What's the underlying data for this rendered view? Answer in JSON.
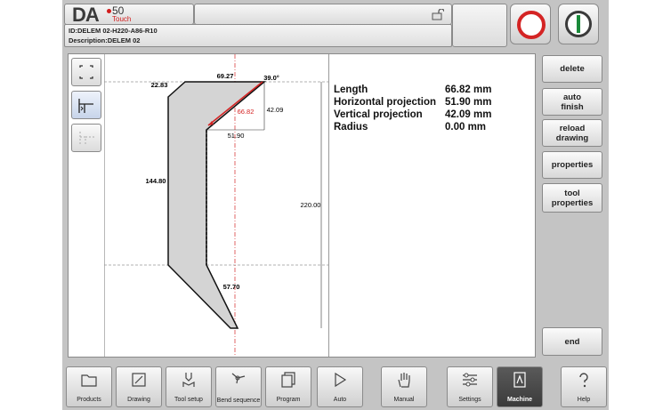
{
  "header": {
    "logo_main": "DA",
    "logo_number": "50",
    "logo_sub": "Touch",
    "product_id": "ID:DELEM 02-H220-A86-R10",
    "description": "Description:DELEM 02"
  },
  "drawing": {
    "dims": {
      "top_left": "22.83",
      "top": "69.27",
      "angle": "39.0°",
      "selected_length": "66.82",
      "vertical_proj": "42.09",
      "horizontal_proj": "51.90",
      "left": "144.80",
      "total_height": "220.00",
      "bottom": "57.70"
    }
  },
  "info": {
    "rows": [
      {
        "label": "Length",
        "value": "66.82 mm"
      },
      {
        "label": "Horizontal projection",
        "value": "51.90 mm"
      },
      {
        "label": "Vertical projection",
        "value": "42.09 mm"
      },
      {
        "label": "Radius",
        "value": "0.00 mm"
      }
    ]
  },
  "side_buttons": {
    "delete": "delete",
    "auto_finish": "auto\nfinish",
    "reload_drawing": "reload\ndrawing",
    "properties": "properties",
    "tool_properties": "tool\nproperties",
    "end": "end"
  },
  "nav": {
    "products": "Products",
    "drawing": "Drawing",
    "tool_setup": "Tool setup",
    "bend_sequence": "Bend sequence",
    "program": "Program",
    "auto": "Auto",
    "manual": "Manual",
    "settings": "Settings",
    "machine": "Machine",
    "help": "Help"
  },
  "colors": {
    "stop": "#d42424",
    "start": "#1a8a3a",
    "selected_segment": "#d42424",
    "active_tab": "#444444"
  }
}
